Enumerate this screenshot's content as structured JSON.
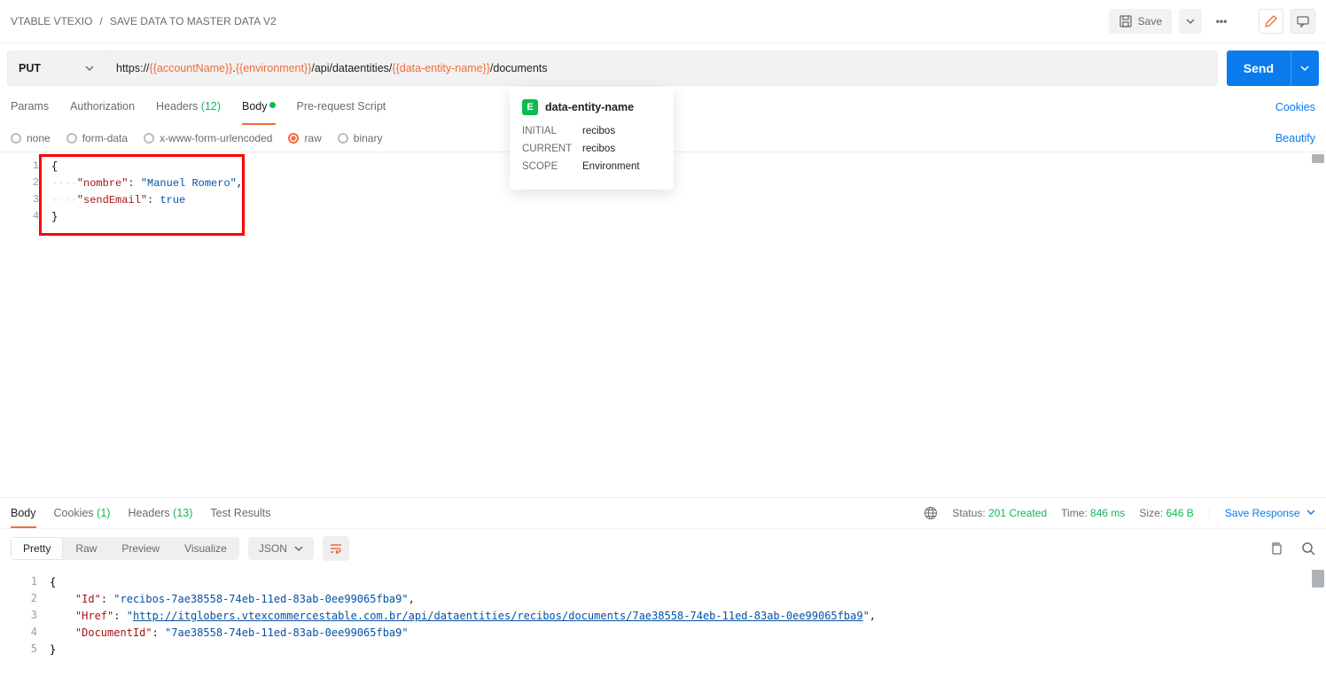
{
  "breadcrumb": {
    "collection": "VTABLE VTEXIO",
    "sep": "/",
    "name": "SAVE DATA TO MASTER DATA V2"
  },
  "actions": {
    "save": "Save"
  },
  "request": {
    "method": "PUT",
    "url_segs": [
      {
        "t": "https://",
        "v": false
      },
      {
        "t": "{{accountName}}",
        "v": true
      },
      {
        "t": ".",
        "v": false
      },
      {
        "t": "{{environment}}",
        "v": true
      },
      {
        "t": "/api/dataentities/",
        "v": false
      },
      {
        "t": "{{data-entity-name}}",
        "v": true
      },
      {
        "t": "/documents",
        "v": false
      }
    ],
    "send": "Send"
  },
  "popover": {
    "title": "data-entity-name",
    "rows": [
      {
        "k": "INITIAL",
        "v": "recibos"
      },
      {
        "k": "CURRENT",
        "v": "recibos"
      },
      {
        "k": "SCOPE",
        "v": "Environment"
      }
    ]
  },
  "tabs": {
    "params": "Params",
    "authorization": "Authorization",
    "headers": "Headers",
    "headers_count": "(12)",
    "body": "Body",
    "prereq": "Pre-request Script",
    "cookies_link": "Cookies"
  },
  "body_types": {
    "none": "none",
    "formdata": "form-data",
    "urlenc": "x-www-form-urlencoded",
    "raw": "raw",
    "binary": "binary",
    "beautify": "Beautify"
  },
  "req_body_lines": [
    "1",
    "2",
    "3",
    "4"
  ],
  "req_body": {
    "l1": "{",
    "l2_key": "\"nombre\"",
    "l2_sep": ": ",
    "l2_val": "\"Manuel Romero\"",
    "l2_end": ",",
    "l3_key": "\"sendEmail\"",
    "l3_sep": ": ",
    "l3_val": "true",
    "l4": "}"
  },
  "resp_tabs": {
    "body": "Body",
    "cookies": "Cookies",
    "cookies_count": "(1)",
    "headers": "Headers",
    "headers_count": "(13)",
    "tests": "Test Results"
  },
  "status": {
    "status_lbl": "Status:",
    "status_val": "201 Created",
    "time_lbl": "Time:",
    "time_val": "846 ms",
    "size_lbl": "Size:",
    "size_val": "646 B",
    "save_resp": "Save Response"
  },
  "viewbar": {
    "pretty": "Pretty",
    "raw": "Raw",
    "preview": "Preview",
    "visualize": "Visualize",
    "json": "JSON"
  },
  "resp_body_lines": [
    "1",
    "2",
    "3",
    "4",
    "5"
  ],
  "resp_body": {
    "l1": "{",
    "l2_key": "\"Id\"",
    "l2_sep": ": ",
    "l2_val": "\"recibos-7ae38558-74eb-11ed-83ab-0ee99065fba9\"",
    "l2_end": ",",
    "l3_key": "\"Href\"",
    "l3_sep": ": ",
    "l3_pre": "\"",
    "l3_link": "http://itglobers.vtexcommercestable.com.br/api/dataentities/recibos/documents/7ae38558-74eb-11ed-83ab-0ee99065fba9",
    "l3_post": "\"",
    "l3_end": ",",
    "l4_key": "\"DocumentId\"",
    "l4_sep": ": ",
    "l4_val": "\"7ae38558-74eb-11ed-83ab-0ee99065fba9\"",
    "l5": "}"
  }
}
